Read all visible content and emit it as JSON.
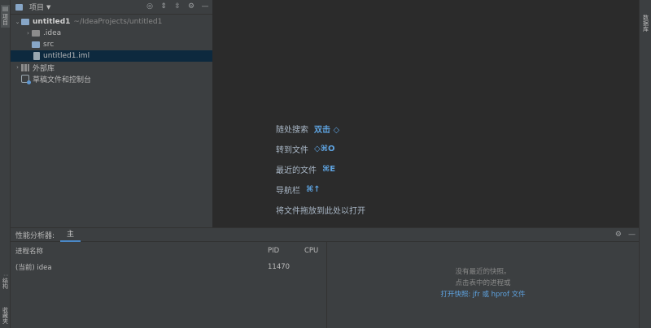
{
  "left_strip": {
    "tab_top_label": "项目",
    "tab_structure_label": "结构",
    "tab_favorites_label": "收藏夹"
  },
  "right_strip": {
    "tab_label": "数据库"
  },
  "project_panel": {
    "title": "项目",
    "tree": [
      {
        "label": "untitled1",
        "path": "~/IdeaProjects/untitled1"
      },
      {
        "label": ".idea"
      },
      {
        "label": "src"
      },
      {
        "label": "untitled1.iml"
      },
      {
        "label": "外部库"
      },
      {
        "label": "草稿文件和控制台"
      }
    ]
  },
  "editor_hints": [
    {
      "text": "随处搜索",
      "key": "双击 ◇"
    },
    {
      "text": "转到文件",
      "key": "◇⌘O"
    },
    {
      "text": "最近的文件",
      "key": "⌘E"
    },
    {
      "text": "导航栏",
      "key": "⌘↑"
    },
    {
      "text": "将文件拖放到此处以打开",
      "key": ""
    }
  ],
  "profiler": {
    "title": "性能分析器:",
    "tab": "主",
    "columns": {
      "name": "进程名称",
      "pid": "PID",
      "cpu": "CPU"
    },
    "rows": [
      {
        "name": "(当前) idea",
        "pid": "11470",
        "cpu": ""
      }
    ],
    "empty": {
      "line1": "没有最近的快照。",
      "line2": "点击表中的进程或",
      "link": "打开快照: jfr 或 hprof 文件"
    }
  },
  "colors": {
    "panel_bg": "#3c3f41",
    "editor_bg": "#2b2b2b",
    "selection": "#0d293e",
    "accent": "#5ea3e0"
  }
}
